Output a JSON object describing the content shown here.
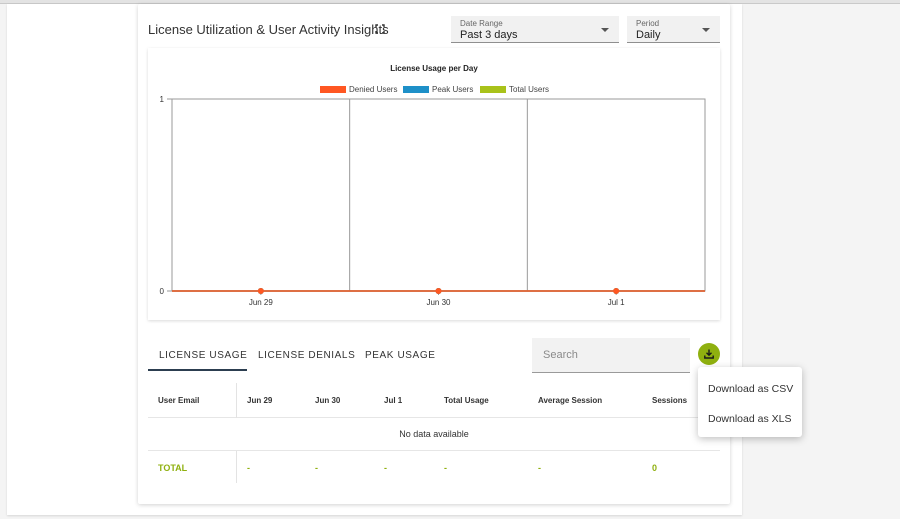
{
  "card": {
    "title": "License Utilization & User Activity Insights",
    "expand_icon": "expand-icon"
  },
  "filters": {
    "date_range": {
      "label": "Date Range",
      "value": "Past 3 days"
    },
    "period": {
      "label": "Period",
      "value": "Daily"
    }
  },
  "chart_data": {
    "type": "line",
    "title": "License Usage per Day",
    "categories": [
      "Jun 29",
      "Jun 30",
      "Jul 1"
    ],
    "y_ticks": [
      "0",
      "1"
    ],
    "ylim": [
      0,
      1
    ],
    "grid": true,
    "legend_position": "top",
    "series": [
      {
        "name": "Denied Users",
        "values": [
          0,
          0,
          0
        ],
        "color": "#ff5722"
      },
      {
        "name": "Peak Users",
        "values": [
          0,
          0,
          0
        ],
        "color": "#1e90c8"
      },
      {
        "name": "Total Users",
        "values": [
          0,
          0,
          0
        ],
        "color": "#a9c21a"
      }
    ]
  },
  "tabs": [
    {
      "label": "LICENSE USAGE",
      "active": true
    },
    {
      "label": "LICENSE DENIALS",
      "active": false
    },
    {
      "label": "PEAK USAGE",
      "active": false
    }
  ],
  "search": {
    "placeholder": "Search"
  },
  "download_icon": "download-icon",
  "table": {
    "columns": [
      "User Email",
      "Jun 29",
      "Jun 30",
      "Jul 1",
      "Total Usage",
      "Average Session",
      "Sessions"
    ],
    "empty_text": "No data available",
    "total_row": [
      "TOTAL",
      "-",
      "-",
      "-",
      "-",
      "-",
      "0"
    ]
  },
  "download_menu": {
    "items": [
      "Download as CSV",
      "Download as XLS"
    ]
  },
  "colors": {
    "accent": "#8fb00f",
    "tab_indicator": "#2c3e50"
  }
}
